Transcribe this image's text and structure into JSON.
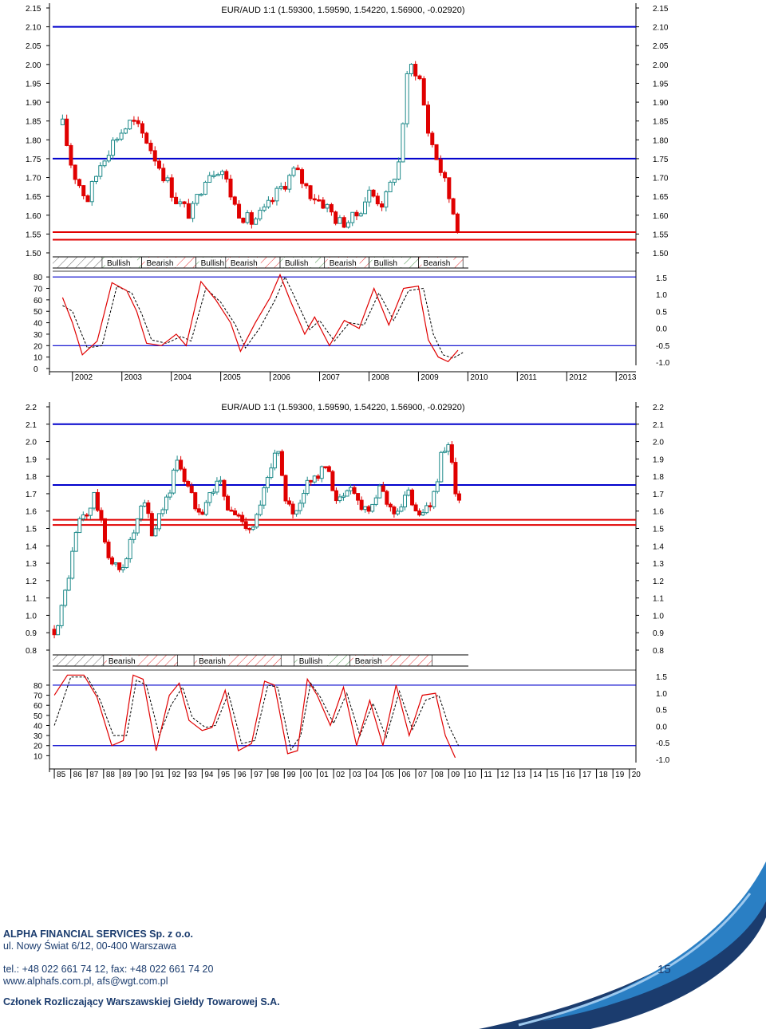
{
  "chart_data": [
    {
      "type": "candlestick",
      "title": "EUR/AUD 1:1 (1.59300, 1.59590, 1.54220, 1.56900, -0.02920)",
      "ylim": [
        1.5,
        2.15
      ],
      "yticks": [
        "2.15",
        "2.10",
        "2.05",
        "2.00",
        "1.95",
        "1.90",
        "1.85",
        "1.80",
        "1.75",
        "1.70",
        "1.65",
        "1.60",
        "1.55",
        "1.50"
      ],
      "horizontal_lines": [
        {
          "value": 2.1,
          "color": "#0000cc"
        },
        {
          "value": 1.75,
          "color": "#0000cc"
        },
        {
          "value": 1.555,
          "color": "#e00000"
        },
        {
          "value": 1.535,
          "color": "#e00000"
        }
      ],
      "close_path": [
        {
          "x": 2001.8,
          "y": 1.84
        },
        {
          "x": 2002.0,
          "y": 1.72
        },
        {
          "x": 2002.3,
          "y": 1.64
        },
        {
          "x": 2002.6,
          "y": 1.75
        },
        {
          "x": 2002.9,
          "y": 1.81
        },
        {
          "x": 2003.2,
          "y": 1.85
        },
        {
          "x": 2003.5,
          "y": 1.8
        },
        {
          "x": 2003.8,
          "y": 1.72
        },
        {
          "x": 2004.1,
          "y": 1.64
        },
        {
          "x": 2004.4,
          "y": 1.6
        },
        {
          "x": 2004.7,
          "y": 1.71
        },
        {
          "x": 2005.0,
          "y": 1.73
        },
        {
          "x": 2005.3,
          "y": 1.62
        },
        {
          "x": 2005.6,
          "y": 1.58
        },
        {
          "x": 2005.9,
          "y": 1.61
        },
        {
          "x": 2006.2,
          "y": 1.67
        },
        {
          "x": 2006.5,
          "y": 1.72
        },
        {
          "x": 2006.8,
          "y": 1.66
        },
        {
          "x": 2007.1,
          "y": 1.63
        },
        {
          "x": 2007.4,
          "y": 1.58
        },
        {
          "x": 2007.7,
          "y": 1.59
        },
        {
          "x": 2008.0,
          "y": 1.66
        },
        {
          "x": 2008.3,
          "y": 1.63
        },
        {
          "x": 2008.6,
          "y": 1.74
        },
        {
          "x": 2008.8,
          "y": 2.0
        },
        {
          "x": 2009.0,
          "y": 1.98
        },
        {
          "x": 2009.2,
          "y": 1.82
        },
        {
          "x": 2009.5,
          "y": 1.7
        },
        {
          "x": 2009.8,
          "y": 1.57
        }
      ],
      "trend_bands": [
        {
          "label": "Bullish",
          "from": 2002.6,
          "to": 2003.4
        },
        {
          "label": "Bearish",
          "from": 2003.4,
          "to": 2004.5
        },
        {
          "label": "Bullish",
          "from": 2004.5,
          "to": 2005.1
        },
        {
          "label": "Bearish",
          "from": 2005.1,
          "to": 2006.2
        },
        {
          "label": "Bullish",
          "from": 2006.2,
          "to": 2007.1
        },
        {
          "label": "Bearish",
          "from": 2007.1,
          "to": 2008.0
        },
        {
          "label": "Bullish",
          "from": 2008.0,
          "to": 2009.0
        },
        {
          "label": "Bearish",
          "from": 2009.0,
          "to": 2009.9
        }
      ],
      "oscillator": {
        "ylim": [
          0,
          85
        ],
        "left_ticks": [
          "80",
          "70",
          "60",
          "50",
          "40",
          "30",
          "20",
          "10",
          "0"
        ],
        "right_ticks": [
          "1.5",
          "1.0",
          "0.5",
          "0.0",
          "-0.5",
          "-1.0"
        ],
        "levels": [
          80,
          20
        ],
        "fast": [
          {
            "x": 2001.8,
            "y": 62
          },
          {
            "x": 2002.0,
            "y": 40
          },
          {
            "x": 2002.2,
            "y": 12
          },
          {
            "x": 2002.5,
            "y": 24
          },
          {
            "x": 2002.8,
            "y": 75
          },
          {
            "x": 2003.1,
            "y": 68
          },
          {
            "x": 2003.3,
            "y": 50
          },
          {
            "x": 2003.5,
            "y": 22
          },
          {
            "x": 2003.8,
            "y": 20
          },
          {
            "x": 2004.1,
            "y": 30
          },
          {
            "x": 2004.3,
            "y": 20
          },
          {
            "x": 2004.6,
            "y": 76
          },
          {
            "x": 2004.9,
            "y": 60
          },
          {
            "x": 2005.2,
            "y": 40
          },
          {
            "x": 2005.4,
            "y": 15
          },
          {
            "x": 2005.7,
            "y": 40
          },
          {
            "x": 2006.0,
            "y": 62
          },
          {
            "x": 2006.2,
            "y": 82
          },
          {
            "x": 2006.4,
            "y": 60
          },
          {
            "x": 2006.7,
            "y": 30
          },
          {
            "x": 2006.9,
            "y": 45
          },
          {
            "x": 2007.2,
            "y": 20
          },
          {
            "x": 2007.5,
            "y": 42
          },
          {
            "x": 2007.8,
            "y": 35
          },
          {
            "x": 2008.1,
            "y": 70
          },
          {
            "x": 2008.4,
            "y": 38
          },
          {
            "x": 2008.7,
            "y": 70
          },
          {
            "x": 2009.0,
            "y": 72
          },
          {
            "x": 2009.2,
            "y": 25
          },
          {
            "x": 2009.4,
            "y": 10
          },
          {
            "x": 2009.6,
            "y": 6
          },
          {
            "x": 2009.8,
            "y": 16
          }
        ],
        "slow": [
          {
            "x": 2001.8,
            "y": 55
          },
          {
            "x": 2002.0,
            "y": 50
          },
          {
            "x": 2002.3,
            "y": 18
          },
          {
            "x": 2002.6,
            "y": 20
          },
          {
            "x": 2002.9,
            "y": 72
          },
          {
            "x": 2003.2,
            "y": 66
          },
          {
            "x": 2003.4,
            "y": 48
          },
          {
            "x": 2003.6,
            "y": 25
          },
          {
            "x": 2003.9,
            "y": 22
          },
          {
            "x": 2004.2,
            "y": 28
          },
          {
            "x": 2004.4,
            "y": 24
          },
          {
            "x": 2004.7,
            "y": 70
          },
          {
            "x": 2005.0,
            "y": 58
          },
          {
            "x": 2005.3,
            "y": 38
          },
          {
            "x": 2005.5,
            "y": 18
          },
          {
            "x": 2005.8,
            "y": 36
          },
          {
            "x": 2006.1,
            "y": 60
          },
          {
            "x": 2006.3,
            "y": 80
          },
          {
            "x": 2006.5,
            "y": 62
          },
          {
            "x": 2006.8,
            "y": 34
          },
          {
            "x": 2007.0,
            "y": 42
          },
          {
            "x": 2007.3,
            "y": 24
          },
          {
            "x": 2007.6,
            "y": 40
          },
          {
            "x": 2007.9,
            "y": 38
          },
          {
            "x": 2008.2,
            "y": 66
          },
          {
            "x": 2008.5,
            "y": 42
          },
          {
            "x": 2008.8,
            "y": 68
          },
          {
            "x": 2009.1,
            "y": 70
          },
          {
            "x": 2009.3,
            "y": 30
          },
          {
            "x": 2009.5,
            "y": 12
          },
          {
            "x": 2009.7,
            "y": 9
          },
          {
            "x": 2009.9,
            "y": 14
          }
        ]
      },
      "x_ticks": [
        "2002",
        "2003",
        "2004",
        "2005",
        "2006",
        "2007",
        "2008",
        "2009",
        "2010",
        "2011",
        "2012",
        "2013"
      ],
      "colors": {
        "bull": "#1e8a8a",
        "bear": "#e00000",
        "level": "#0000cc"
      }
    },
    {
      "type": "candlestick",
      "title": "EUR/AUD 1:1 (1.59300, 1.59590, 1.54220, 1.56900, -0.02920)",
      "ylim": [
        0.8,
        2.2
      ],
      "yticks": [
        "2.2",
        "2.1",
        "2.0",
        "1.9",
        "1.8",
        "1.7",
        "1.6",
        "1.5",
        "1.4",
        "1.3",
        "1.2",
        "1.1",
        "1.0",
        "0.9",
        "0.8"
      ],
      "horizontal_lines": [
        {
          "value": 2.1,
          "color": "#0000cc"
        },
        {
          "value": 1.75,
          "color": "#0000cc"
        },
        {
          "value": 1.55,
          "color": "#e00000"
        },
        {
          "value": 1.52,
          "color": "#e00000"
        }
      ],
      "close_path": [
        {
          "x": 1985.0,
          "y": 0.92
        },
        {
          "x": 1985.5,
          "y": 1.05
        },
        {
          "x": 1986.0,
          "y": 1.3
        },
        {
          "x": 1986.5,
          "y": 1.55
        },
        {
          "x": 1987.0,
          "y": 1.58
        },
        {
          "x": 1987.5,
          "y": 1.7
        },
        {
          "x": 1988.0,
          "y": 1.45
        },
        {
          "x": 1988.5,
          "y": 1.3
        },
        {
          "x": 1989.0,
          "y": 1.25
        },
        {
          "x": 1989.5,
          "y": 1.38
        },
        {
          "x": 1990.0,
          "y": 1.52
        },
        {
          "x": 1990.5,
          "y": 1.65
        },
        {
          "x": 1991.0,
          "y": 1.45
        },
        {
          "x": 1991.5,
          "y": 1.62
        },
        {
          "x": 1992.0,
          "y": 1.7
        },
        {
          "x": 1992.5,
          "y": 1.92
        },
        {
          "x": 1993.0,
          "y": 1.76
        },
        {
          "x": 1993.5,
          "y": 1.65
        },
        {
          "x": 1994.0,
          "y": 1.62
        },
        {
          "x": 1994.5,
          "y": 1.7
        },
        {
          "x": 1995.0,
          "y": 1.8
        },
        {
          "x": 1995.5,
          "y": 1.62
        },
        {
          "x": 1996.0,
          "y": 1.58
        },
        {
          "x": 1996.5,
          "y": 1.55
        },
        {
          "x": 1997.0,
          "y": 1.5
        },
        {
          "x": 1997.5,
          "y": 1.6
        },
        {
          "x": 1998.0,
          "y": 1.8
        },
        {
          "x": 1998.5,
          "y": 2.0
        },
        {
          "x": 1999.0,
          "y": 1.7
        },
        {
          "x": 1999.5,
          "y": 1.55
        },
        {
          "x": 2000.0,
          "y": 1.62
        },
        {
          "x": 2000.5,
          "y": 1.8
        },
        {
          "x": 2001.0,
          "y": 1.8
        },
        {
          "x": 2001.5,
          "y": 1.85
        },
        {
          "x": 2002.0,
          "y": 1.72
        },
        {
          "x": 2002.5,
          "y": 1.64
        },
        {
          "x": 2003.0,
          "y": 1.78
        },
        {
          "x": 2003.5,
          "y": 1.65
        },
        {
          "x": 2004.0,
          "y": 1.62
        },
        {
          "x": 2004.5,
          "y": 1.68
        },
        {
          "x": 2005.0,
          "y": 1.72
        },
        {
          "x": 2005.5,
          "y": 1.6
        },
        {
          "x": 2006.0,
          "y": 1.62
        },
        {
          "x": 2006.5,
          "y": 1.7
        },
        {
          "x": 2007.0,
          "y": 1.63
        },
        {
          "x": 2007.5,
          "y": 1.58
        },
        {
          "x": 2008.0,
          "y": 1.65
        },
        {
          "x": 2008.5,
          "y": 1.9
        },
        {
          "x": 2009.0,
          "y": 1.95
        },
        {
          "x": 2009.5,
          "y": 1.7
        },
        {
          "x": 2009.8,
          "y": 1.57
        }
      ],
      "trend_bands": [
        {
          "label": "Bearish",
          "from": 1988.0,
          "to": 1992.5
        },
        {
          "label": "Bearish",
          "from": 1993.5,
          "to": 1998.8
        },
        {
          "label": "Bullish",
          "from": 1999.6,
          "to": 2003.0
        },
        {
          "label": "Bearish",
          "from": 2003.0,
          "to": 2008.0
        }
      ],
      "oscillator": {
        "ylim": [
          0,
          95
        ],
        "left_ticks": [
          "80",
          "70",
          "60",
          "50",
          "40",
          "30",
          "20",
          "10"
        ],
        "right_ticks": [
          "1.5",
          "1.0",
          "0.5",
          "0.0",
          "-0.5",
          "-1.0"
        ],
        "levels": [
          80,
          20
        ],
        "fast": [
          {
            "x": 1985.0,
            "y": 70
          },
          {
            "x": 1985.8,
            "y": 90
          },
          {
            "x": 1986.8,
            "y": 90
          },
          {
            "x": 1987.6,
            "y": 68
          },
          {
            "x": 1988.5,
            "y": 20
          },
          {
            "x": 1989.2,
            "y": 25
          },
          {
            "x": 1989.8,
            "y": 90
          },
          {
            "x": 1990.4,
            "y": 86
          },
          {
            "x": 1991.2,
            "y": 15
          },
          {
            "x": 1992.0,
            "y": 70
          },
          {
            "x": 1992.6,
            "y": 82
          },
          {
            "x": 1993.2,
            "y": 45
          },
          {
            "x": 1994.0,
            "y": 35
          },
          {
            "x": 1994.6,
            "y": 38
          },
          {
            "x": 1995.4,
            "y": 75
          },
          {
            "x": 1996.2,
            "y": 15
          },
          {
            "x": 1997.0,
            "y": 22
          },
          {
            "x": 1997.8,
            "y": 84
          },
          {
            "x": 1998.4,
            "y": 80
          },
          {
            "x": 1999.2,
            "y": 12
          },
          {
            "x": 1999.8,
            "y": 15
          },
          {
            "x": 2000.4,
            "y": 86
          },
          {
            "x": 2001.0,
            "y": 70
          },
          {
            "x": 2001.8,
            "y": 40
          },
          {
            "x": 2002.6,
            "y": 78
          },
          {
            "x": 2003.4,
            "y": 20
          },
          {
            "x": 2004.2,
            "y": 65
          },
          {
            "x": 2005.0,
            "y": 20
          },
          {
            "x": 2005.8,
            "y": 80
          },
          {
            "x": 2006.6,
            "y": 30
          },
          {
            "x": 2007.4,
            "y": 70
          },
          {
            "x": 2008.2,
            "y": 72
          },
          {
            "x": 2008.8,
            "y": 30
          },
          {
            "x": 2009.4,
            "y": 8
          }
        ],
        "slow": [
          {
            "x": 1985.0,
            "y": 40
          },
          {
            "x": 1986.0,
            "y": 88
          },
          {
            "x": 1987.0,
            "y": 88
          },
          {
            "x": 1987.8,
            "y": 65
          },
          {
            "x": 1988.6,
            "y": 30
          },
          {
            "x": 1989.4,
            "y": 30
          },
          {
            "x": 1990.0,
            "y": 85
          },
          {
            "x": 1990.6,
            "y": 80
          },
          {
            "x": 1991.4,
            "y": 30
          },
          {
            "x": 1992.1,
            "y": 60
          },
          {
            "x": 1992.8,
            "y": 78
          },
          {
            "x": 1993.4,
            "y": 48
          },
          {
            "x": 1994.2,
            "y": 38
          },
          {
            "x": 1994.8,
            "y": 40
          },
          {
            "x": 1995.6,
            "y": 72
          },
          {
            "x": 1996.4,
            "y": 22
          },
          {
            "x": 1997.2,
            "y": 25
          },
          {
            "x": 1998.0,
            "y": 80
          },
          {
            "x": 1998.6,
            "y": 78
          },
          {
            "x": 1999.4,
            "y": 16
          },
          {
            "x": 2000.0,
            "y": 30
          },
          {
            "x": 2000.6,
            "y": 82
          },
          {
            "x": 2001.2,
            "y": 68
          },
          {
            "x": 2002.0,
            "y": 42
          },
          {
            "x": 2002.8,
            "y": 72
          },
          {
            "x": 2003.6,
            "y": 30
          },
          {
            "x": 2004.4,
            "y": 62
          },
          {
            "x": 2005.2,
            "y": 28
          },
          {
            "x": 2006.0,
            "y": 74
          },
          {
            "x": 2006.8,
            "y": 36
          },
          {
            "x": 2007.6,
            "y": 65
          },
          {
            "x": 2008.4,
            "y": 70
          },
          {
            "x": 2009.0,
            "y": 40
          },
          {
            "x": 2009.6,
            "y": 20
          }
        ]
      },
      "x_ticks": [
        "85",
        "86",
        "87",
        "88",
        "89",
        "90",
        "91",
        "92",
        "93",
        "94",
        "95",
        "96",
        "97",
        "98",
        "99",
        "00",
        "01",
        "02",
        "03",
        "04",
        "05",
        "06",
        "07",
        "08",
        "09",
        "10",
        "11",
        "12",
        "13",
        "14",
        "15",
        "16",
        "17",
        "18",
        "19",
        "20"
      ],
      "colors": {
        "bull": "#1e8a8a",
        "bear": "#e00000",
        "level": "#0000cc"
      }
    }
  ],
  "footer": {
    "company": "ALPHA FINANCIAL SERVICES Sp. z o.o.",
    "address": "ul. Nowy Świat 6/12, 00-400 Warszawa",
    "phone": "tel.: +48 022 661 74 12, fax: +48 022 661 74 20",
    "web": "www.alphafs.com.pl, afs@wgt.com.pl",
    "member": "Członek Rozliczający Warszawskiej Giełdy Towarowej S.A.",
    "page_number": "15"
  }
}
